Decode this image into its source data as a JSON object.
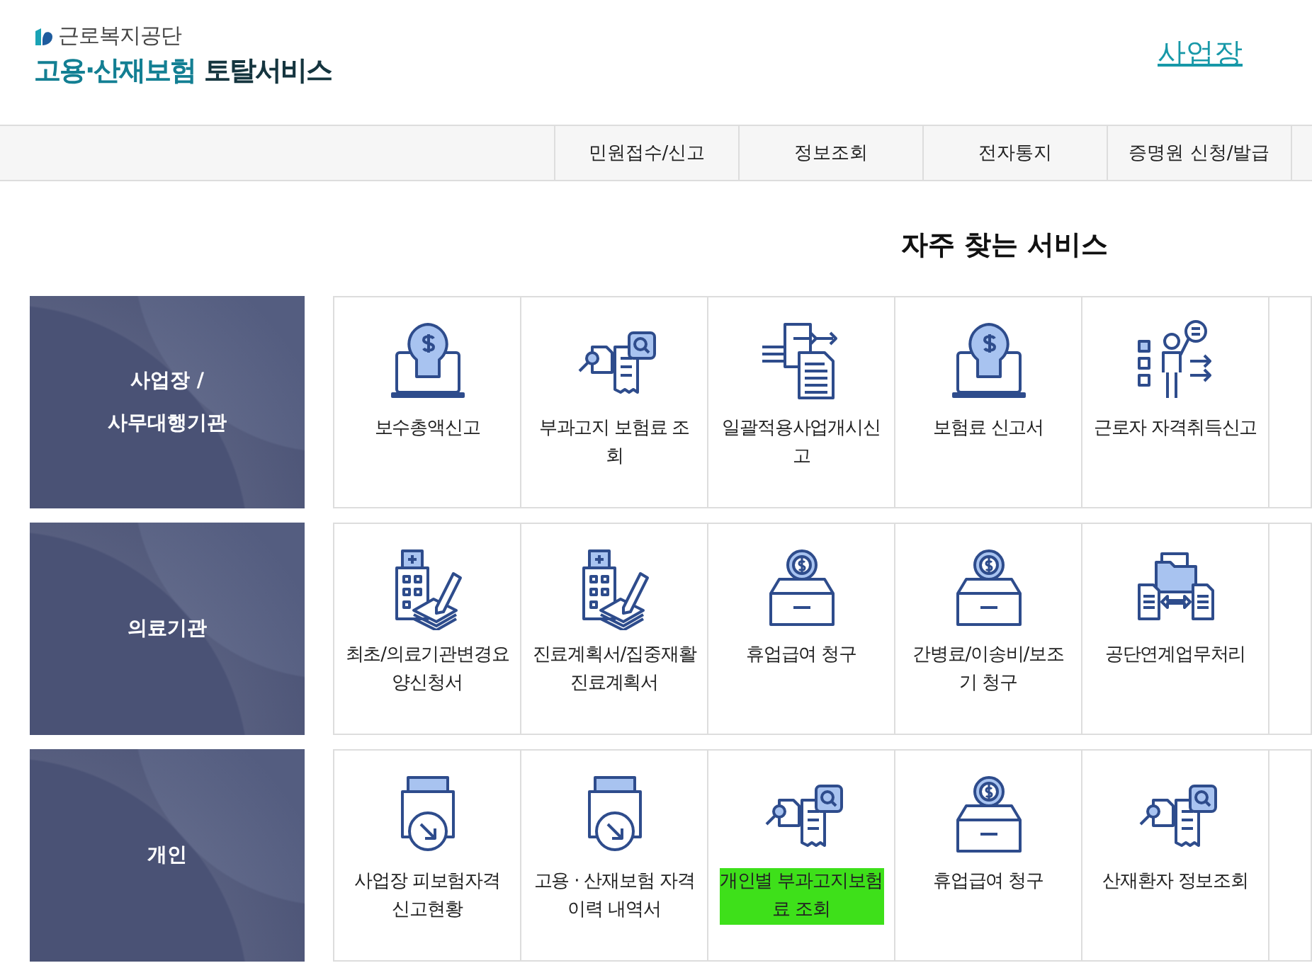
{
  "header": {
    "org_name": "근로복지공단",
    "title_highlight": "고용·산재보험",
    "title_rest": "토탈서비스",
    "links": [
      {
        "label": "사업장",
        "selected": true
      }
    ]
  },
  "nav": {
    "items": [
      "민원접수/신고",
      "정보조회",
      "전자통지",
      "증명원 신청/발급"
    ]
  },
  "section_title": "자주 찾는 서비스",
  "groups": [
    {
      "category": "사업장 /\n사무대행기관",
      "services": [
        {
          "kind": "bulb",
          "label": "보수총액신고",
          "highlighted": false
        },
        {
          "kind": "search",
          "label": "부과고지 보험료 조회",
          "highlighted": false
        },
        {
          "kind": "transfer",
          "label": "일괄적용사업개시신고",
          "highlighted": false
        },
        {
          "kind": "bulb",
          "label": "보험료 신고서",
          "highlighted": false
        },
        {
          "kind": "worker",
          "label": "근로자 자격취득신고",
          "highlighted": false
        },
        {
          "kind": "cut"
        }
      ]
    },
    {
      "category": "의료기관",
      "services": [
        {
          "kind": "hospital",
          "label": "최초/의료기관변경요양신청서",
          "highlighted": false
        },
        {
          "kind": "hospital",
          "label": "진료계획서/집중재활진료계획서",
          "highlighted": false
        },
        {
          "kind": "coinbox",
          "label": "휴업급여 청구",
          "highlighted": false
        },
        {
          "kind": "coinbox",
          "label": "간병료/이송비/보조기 청구",
          "highlighted": false
        },
        {
          "kind": "exchange",
          "label": "공단연계업무처리",
          "highlighted": false
        },
        {
          "kind": "cut"
        }
      ]
    },
    {
      "category": "개인",
      "services": [
        {
          "kind": "printer",
          "label": "사업장 피보험자격 신고현황",
          "highlighted": false
        },
        {
          "kind": "printer",
          "label": "고용 · 산재보험 자격 이력 내역서",
          "highlighted": false
        },
        {
          "kind": "search",
          "label": "개인별 부과고지보험료 조회",
          "highlighted": true
        },
        {
          "kind": "coinbox",
          "label": "휴업급여 청구",
          "highlighted": false
        },
        {
          "kind": "search",
          "label": "산재환자 정보조회",
          "highlighted": false
        },
        {
          "kind": "cut"
        }
      ]
    }
  ]
}
